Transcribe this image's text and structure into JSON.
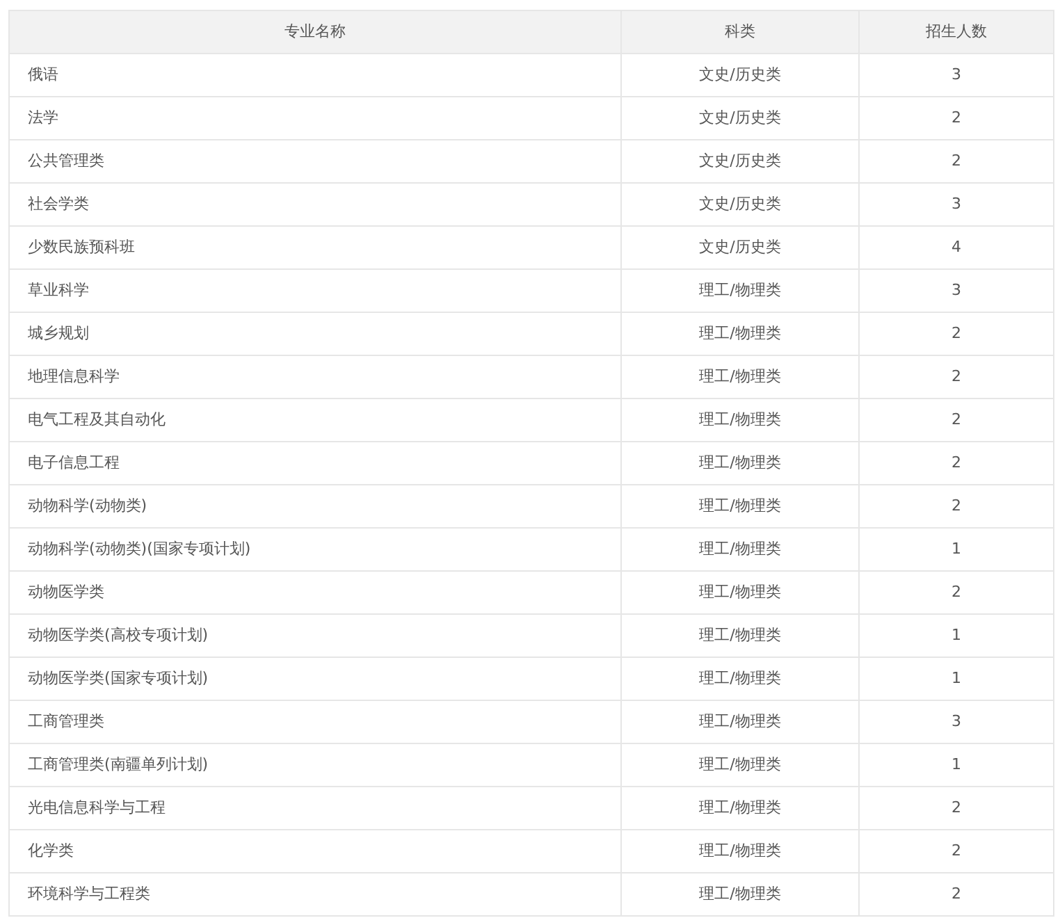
{
  "table": {
    "columns": [
      "专业名称",
      "科类",
      "招生人数"
    ],
    "rows": [
      [
        "俄语",
        "文史/历史类",
        "3"
      ],
      [
        "法学",
        "文史/历史类",
        "2"
      ],
      [
        "公共管理类",
        "文史/历史类",
        "2"
      ],
      [
        "社会学类",
        "文史/历史类",
        "3"
      ],
      [
        "少数民族预科班",
        "文史/历史类",
        "4"
      ],
      [
        "草业科学",
        "理工/物理类",
        "3"
      ],
      [
        "城乡规划",
        "理工/物理类",
        "2"
      ],
      [
        "地理信息科学",
        "理工/物理类",
        "2"
      ],
      [
        "电气工程及其自动化",
        "理工/物理类",
        "2"
      ],
      [
        "电子信息工程",
        "理工/物理类",
        "2"
      ],
      [
        "动物科学(动物类)",
        "理工/物理类",
        "2"
      ],
      [
        "动物科学(动物类)(国家专项计划)",
        "理工/物理类",
        "1"
      ],
      [
        "动物医学类",
        "理工/物理类",
        "2"
      ],
      [
        "动物医学类(高校专项计划)",
        "理工/物理类",
        "1"
      ],
      [
        "动物医学类(国家专项计划)",
        "理工/物理类",
        "1"
      ],
      [
        "工商管理类",
        "理工/物理类",
        "3"
      ],
      [
        "工商管理类(南疆单列计划)",
        "理工/物理类",
        "1"
      ],
      [
        "光电信息科学与工程",
        "理工/物理类",
        "2"
      ],
      [
        "化学类",
        "理工/物理类",
        "2"
      ],
      [
        "环境科学与工程类",
        "理工/物理类",
        "2"
      ]
    ]
  }
}
